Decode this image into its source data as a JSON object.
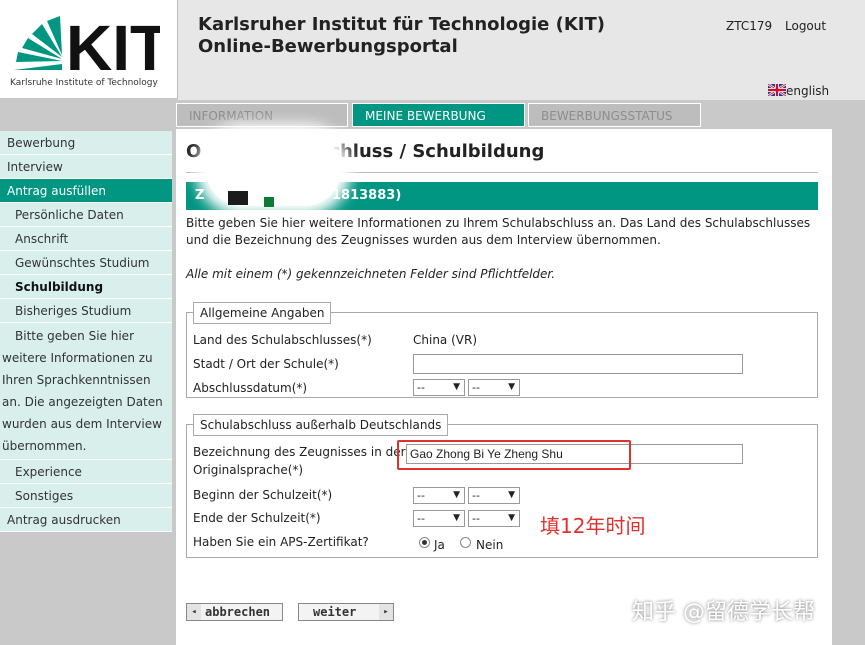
{
  "header": {
    "logo_text": "KIT",
    "logo_subtitle": "Karlsruhe Institute of Technology",
    "title_line1": "Karlsruher Institut für Technologie (KIT)",
    "title_line2": "Online-Bewerbungsportal",
    "user_id": "ZTC179",
    "logout": "Logout",
    "language": "english"
  },
  "tabs": [
    {
      "label": "INFORMATION",
      "state": "inactive"
    },
    {
      "label": "MEINE BEWERBUNG",
      "state": "active"
    },
    {
      "label": "BEWERBUNGSSTATUS",
      "state": "inactive"
    }
  ],
  "sidebar": {
    "items": [
      {
        "label": "Bewerbung"
      },
      {
        "label": "Interview"
      },
      {
        "label": "Antrag ausfüllen"
      },
      {
        "label": "Persönliche Daten"
      },
      {
        "label": "Anschrift"
      },
      {
        "label": "Gewünschtes Studium"
      },
      {
        "label": "Schulbildung"
      },
      {
        "label": "Bisheriges Studium"
      },
      {
        "label_lines": [
          "Bitte geben Sie hier",
          "weitere Informationen zu",
          "Ihren Sprachkenntnissen",
          "an. Die angezeigten Daten",
          "wurden aus dem Interview",
          "übernommen."
        ]
      },
      {
        "label": "Experience"
      },
      {
        "label": "Sonstiges"
      },
      {
        "label": "Antrag ausdrucken"
      }
    ]
  },
  "main": {
    "page_title_left": "O",
    "page_title_right": "chluss / Schulbildung",
    "bar_left": "Z",
    "bar_right": "1813883)",
    "intro": "Bitte geben Sie hier weitere Informationen zu Ihrem Schulabschluss an. Das Land des Schulabschlusses und die Bezeichnung des Zeugnisses wurden aus dem Interview übernommen.",
    "required_hint": "Alle mit einem (*) gekennzeichneten Felder sind Pflichtfelder.",
    "section1": {
      "legend": "Allgemeine Angaben",
      "country_label": "Land des Schulabschlusses(*)",
      "country_value": "China (VR)",
      "city_label": "Stadt / Ort der Schule(*)",
      "city_value": "",
      "date_label": "Abschlussdatum(*)",
      "date_month": "--",
      "date_year": "--"
    },
    "section2": {
      "legend": "Schulabschluss außerhalb Deutschlands",
      "cert_label_line1": "Bezeichnung des Zeugnisses in der",
      "cert_label_line2": "Originalsprache(*)",
      "cert_value": "Gao Zhong Bi Ye Zheng Shu",
      "start_label": "Beginn der Schulzeit(*)",
      "start_month": "--",
      "start_year": "--",
      "end_label": "Ende der Schulzeit(*)",
      "end_month": "--",
      "end_year": "--",
      "aps_label": "Haben Sie ein APS-Zertifikat?",
      "aps_yes": "Ja",
      "aps_no": "Nein",
      "aps_selected": "Ja"
    },
    "annotation": "填12年时间",
    "buttons": {
      "cancel": "abbrechen",
      "next": "weiter"
    }
  },
  "watermark": "知乎 @留德学长帮",
  "colors": {
    "kit_green": "#009682",
    "annotation_red": "#e0312d",
    "sidebar_bg": "#d8efec"
  }
}
